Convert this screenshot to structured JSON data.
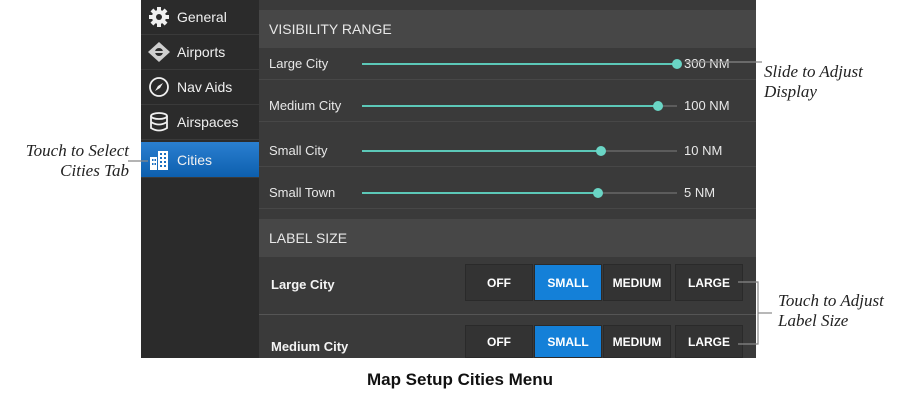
{
  "sidebar": {
    "items": [
      {
        "label": "General",
        "icon": "gear-icon"
      },
      {
        "label": "Airports",
        "icon": "airport-icon"
      },
      {
        "label": "Nav Aids",
        "icon": "compass-icon"
      },
      {
        "label": "Airspaces",
        "icon": "airspace-icon"
      },
      {
        "label": "Cities",
        "icon": "city-icon",
        "active": true
      }
    ]
  },
  "visibility": {
    "heading": "VISIBILITY RANGE",
    "rows": [
      {
        "label": "Large City",
        "value": "300 NM",
        "level_pct": 100
      },
      {
        "label": "Medium City",
        "value": "100 NM",
        "level_pct": 94
      },
      {
        "label": "Small City",
        "value": "10 NM",
        "level_pct": 76
      },
      {
        "label": "Small Town",
        "value": "5 NM",
        "level_pct": 75
      }
    ]
  },
  "label_size": {
    "heading": "LABEL SIZE",
    "options": [
      "OFF",
      "SMALL",
      "MEDIUM",
      "LARGE"
    ],
    "rows": [
      {
        "label": "Large City",
        "selected": "SMALL"
      },
      {
        "label": "Medium City",
        "selected": "SMALL"
      }
    ]
  },
  "annotations": {
    "select_tab_1": "Touch to Select",
    "select_tab_2": "Cities Tab",
    "slide_1": "Slide to Adjust",
    "slide_2": "Display",
    "label_size_1": "Touch to Adjust",
    "label_size_2": "Label Size"
  },
  "caption": "Map Setup Cities Menu",
  "colors": {
    "accent": "#1480d8",
    "slider": "#5cc8b8",
    "panel": "#3a3a3a",
    "sidebar": "#2b2b2b"
  }
}
